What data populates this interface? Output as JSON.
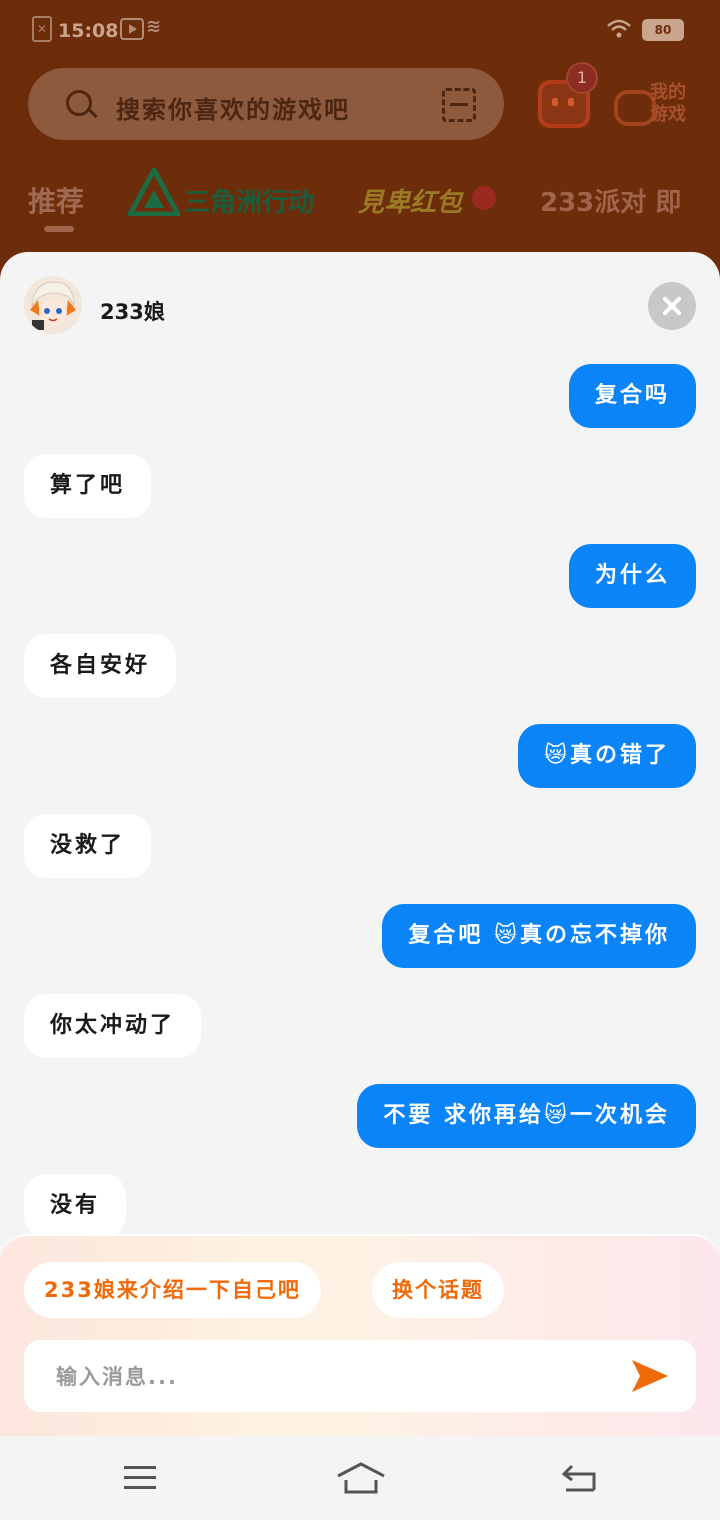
{
  "status_bar": {
    "time": "15:08",
    "battery": "80"
  },
  "search": {
    "placeholder": "搜索你喜欢的游戏吧"
  },
  "header": {
    "message_badge": "1",
    "my_games_label": "我的游戏"
  },
  "tabs": [
    {
      "label": "推荐"
    },
    {
      "label": "三角洲行动"
    },
    {
      "label": "見卑红包"
    },
    {
      "label": "233派对 即"
    }
  ],
  "chat": {
    "bot_name": "233娘",
    "messages": [
      {
        "from": "me",
        "text": "复合吗"
      },
      {
        "from": "bot",
        "text": "算了吧"
      },
      {
        "from": "me",
        "text": "为什么"
      },
      {
        "from": "bot",
        "text": "各自安好"
      },
      {
        "from": "me",
        "text": "😿真の错了"
      },
      {
        "from": "bot",
        "text": "没救了"
      },
      {
        "from": "me",
        "text": "复合吧 😿真の忘不掉你"
      },
      {
        "from": "bot",
        "text": "你太冲动了"
      },
      {
        "from": "me",
        "text": "不要 求你再给😿一次机会"
      },
      {
        "from": "bot",
        "text": "没有"
      }
    ]
  },
  "suggestions": [
    {
      "label": "233娘来介绍一下自己吧"
    },
    {
      "label": "换个话题"
    }
  ],
  "composer": {
    "placeholder": "输入消息..."
  },
  "colors": {
    "accent": "#0a84f6",
    "orange": "#f06a0c"
  },
  "icons": [
    "search-icon",
    "scan-icon",
    "message-icon",
    "gamepad-icon",
    "close-icon",
    "send-icon",
    "menu-icon",
    "home-icon",
    "back-icon"
  ]
}
